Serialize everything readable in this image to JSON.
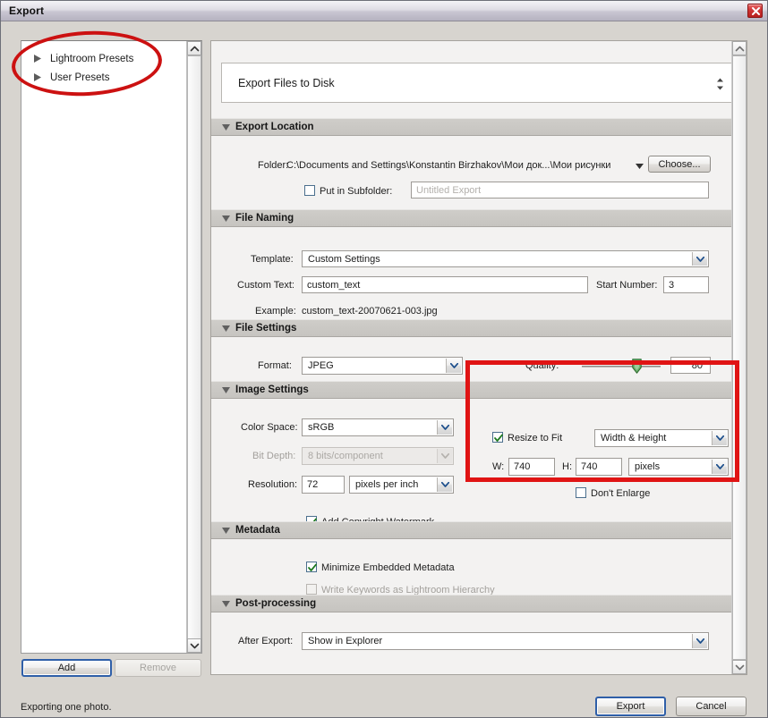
{
  "window": {
    "title": "Export",
    "close_icon": "close-icon"
  },
  "sidebar": {
    "presets": [
      {
        "label": "Lightroom Presets",
        "icon": "triangle-right-icon"
      },
      {
        "label": "User Presets",
        "icon": "triangle-right-icon"
      }
    ],
    "add_label": "Add",
    "remove_label": "Remove"
  },
  "main": {
    "preset_combo": {
      "value": "Export Files to Disk",
      "icon": "updown-spinner-icon"
    },
    "sections": {
      "export_location": {
        "title": "Export Location",
        "folder_label": "Folder:",
        "folder_value": "C:\\Documents and Settings\\Konstantin Birzhakov\\Мои док...\\Мои рисунки",
        "folder_dropdown_icon": "triangle-down-icon",
        "choose_label": "Choose...",
        "put_in_subfolder_label": "Put in Subfolder:",
        "put_in_subfolder_checked": false,
        "subfolder_placeholder": "Untitled Export"
      },
      "file_naming": {
        "title": "File Naming",
        "template_label": "Template:",
        "template_value": "Custom Settings",
        "custom_text_label": "Custom Text:",
        "custom_text_value": "custom_text",
        "start_number_label": "Start Number:",
        "start_number_value": "3",
        "example_label": "Example:",
        "example_value": "custom_text-20070621-003.jpg"
      },
      "file_settings": {
        "title": "File Settings",
        "format_label": "Format:",
        "format_value": "JPEG",
        "quality_label": "Quality:",
        "quality_value": "80"
      },
      "image_settings": {
        "title": "Image Settings",
        "color_space_label": "Color Space:",
        "color_space_value": "sRGB",
        "bit_depth_label": "Bit Depth:",
        "bit_depth_value": "8 bits/component",
        "bit_depth_disabled": true,
        "resolution_label": "Resolution:",
        "resolution_value": "72",
        "resolution_unit_value": "pixels per inch",
        "watermark_label": "Add Copyright Watermark",
        "watermark_checked": true,
        "resize_to_fit_label": "Resize to Fit",
        "resize_to_fit_checked": true,
        "resize_mode_value": "Width & Height",
        "width_label": "W:",
        "width_value": "740",
        "height_label": "H:",
        "height_value": "740",
        "units_value": "pixels",
        "dont_enlarge_label": "Don't Enlarge",
        "dont_enlarge_checked": false
      },
      "metadata": {
        "title": "Metadata",
        "minimize_label": "Minimize Embedded Metadata",
        "minimize_checked": true,
        "keywords_label": "Write Keywords as Lightroom Hierarchy",
        "keywords_checked": false,
        "keywords_disabled": true
      },
      "post_processing": {
        "title": "Post-processing",
        "after_export_label": "After Export:",
        "after_export_value": "Show in Explorer"
      }
    }
  },
  "footer": {
    "status": "Exporting one photo.",
    "export_label": "Export",
    "cancel_label": "Cancel"
  },
  "annotations": {
    "color": "#d01414",
    "ellipse_target": "presets-tree",
    "rect_target": "resize-to-fit-group"
  }
}
